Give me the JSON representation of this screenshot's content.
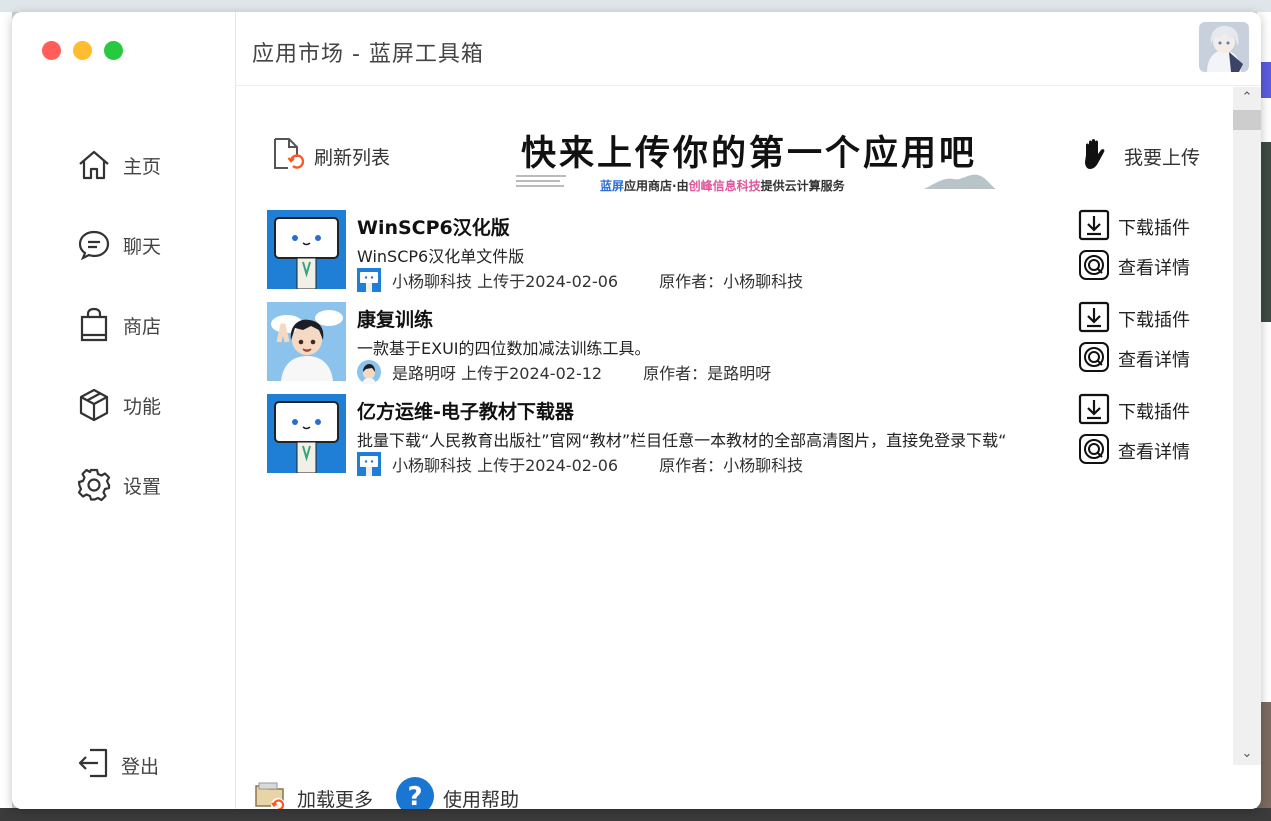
{
  "window": {
    "title": "应用市场 - 蓝屏工具箱"
  },
  "sidebar": {
    "items": [
      {
        "label": "主页",
        "icon": "home-icon"
      },
      {
        "label": "聊天",
        "icon": "chat-icon"
      },
      {
        "label": "商店",
        "icon": "shopping-bag-icon"
      },
      {
        "label": "功能",
        "icon": "cube-icon"
      },
      {
        "label": "设置",
        "icon": "gear-icon"
      }
    ],
    "logout_label": "登出"
  },
  "toolbar": {
    "refresh_label": "刷新列表",
    "upload_label": "我要上传"
  },
  "banner": {
    "headline": "快来上传你的第一个应用吧",
    "sub_a": "蓝屏",
    "sub_b": "应用商店·由",
    "sub_c": "创峰信息科技",
    "sub_d": "提供云计算服务"
  },
  "apps": [
    {
      "name": "WinSCP6汉化版",
      "description": "WinSCP6汉化单文件版",
      "uploader_line": "小杨聊科技 上传于2024-02-06",
      "author_line": "原作者：小杨聊科技",
      "download_label": "下载插件",
      "details_label": "查看详情"
    },
    {
      "name": "康复训练",
      "description": "一款基于EXUI的四位数加减法训练工具。",
      "uploader_line": "是路明呀 上传于2024-02-12",
      "author_line": "原作者：是路明呀",
      "download_label": "下载插件",
      "details_label": "查看详情"
    },
    {
      "name": "亿方运维-电子教材下载器",
      "description": "批量下载“人民教育出版社”官网“教材”栏目任意一本教材的全部高清图片，直接免登录下载“",
      "uploader_line": "小杨聊科技 上传于2024-02-06",
      "author_line": "原作者：小杨聊科技",
      "download_label": "下载插件",
      "details_label": "查看详情"
    }
  ],
  "footer": {
    "load_more_label": "加载更多",
    "help_label": "使用帮助"
  },
  "colors": {
    "traffic_red": "#ff5f57",
    "traffic_yellow": "#febc2e",
    "traffic_green": "#28c840",
    "app_icon_blue": "#1f7fd6",
    "help_blue": "#1976d2"
  }
}
